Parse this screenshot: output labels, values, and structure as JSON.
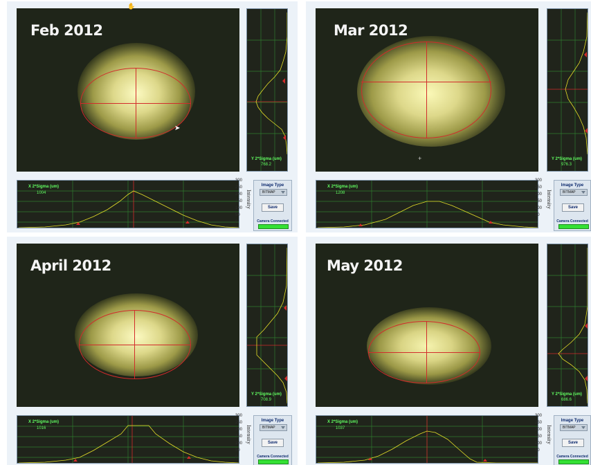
{
  "panels": [
    {
      "month": "Feb 2012",
      "x_sigma_label": "X 2*Sigma (um)",
      "x_sigma_value": "1004",
      "y_sigma_label": "Y 2*Sigma (um)",
      "y_sigma_value": "768.2",
      "image_type_label": "Image Type",
      "image_type_value": "BITMAP",
      "save_label": "Save",
      "camera_status": "Camera Connected",
      "intensity_label": "Intensity",
      "ticks": [
        "300",
        "250",
        "200",
        "150",
        "100",
        "50",
        "0"
      ]
    },
    {
      "month": "Mar 2012",
      "x_sigma_label": "X 2*Sigma (um)",
      "x_sigma_value": "1208",
      "y_sigma_label": "Y 2*Sigma (um)",
      "y_sigma_value": "976.3",
      "image_type_label": "Image Type",
      "image_type_value": "BITMAP",
      "save_label": "Save",
      "camera_status": "Camera Connected",
      "intensity_label": "Intensity",
      "ticks": [
        "300",
        "250",
        "200",
        "150",
        "100",
        "50",
        "0"
      ]
    },
    {
      "month": "April 2012",
      "x_sigma_label": "X 2*Sigma (um)",
      "x_sigma_value": "1016",
      "y_sigma_label": "Y 2*Sigma (um)",
      "y_sigma_value": "708.9",
      "image_type_label": "Image Type",
      "image_type_value": "BITMAP",
      "save_label": "Save",
      "camera_status": "Camera Connected",
      "intensity_label": "Intensity",
      "ticks": [
        "300",
        "250",
        "200",
        "150",
        "100",
        "50",
        "0"
      ]
    },
    {
      "month": "May 2012",
      "x_sigma_label": "X 2*Sigma (um)",
      "x_sigma_value": "1037",
      "y_sigma_label": "Y 2*Sigma (um)",
      "y_sigma_value": "686.6",
      "image_type_label": "Image Type",
      "image_type_value": "BITMAP",
      "save_label": "Save",
      "camera_status": "Camera Connected",
      "intensity_label": "Intensity",
      "ticks": [
        "300",
        "250",
        "200",
        "150",
        "100",
        "50",
        "0"
      ]
    }
  ],
  "colors": {
    "beam_center": "#fbf9b8",
    "beam_edge": "#8c8a38",
    "ellipse": "#d22b2b",
    "trace": "#e6e028",
    "grid": "#2f7c2f",
    "readout": "#62ff62",
    "camera_led": "#34e034"
  },
  "icons": [
    "mouse-pointer-icon",
    "crosshair-cursor-icon",
    "dropdown-arrow-icon"
  ]
}
